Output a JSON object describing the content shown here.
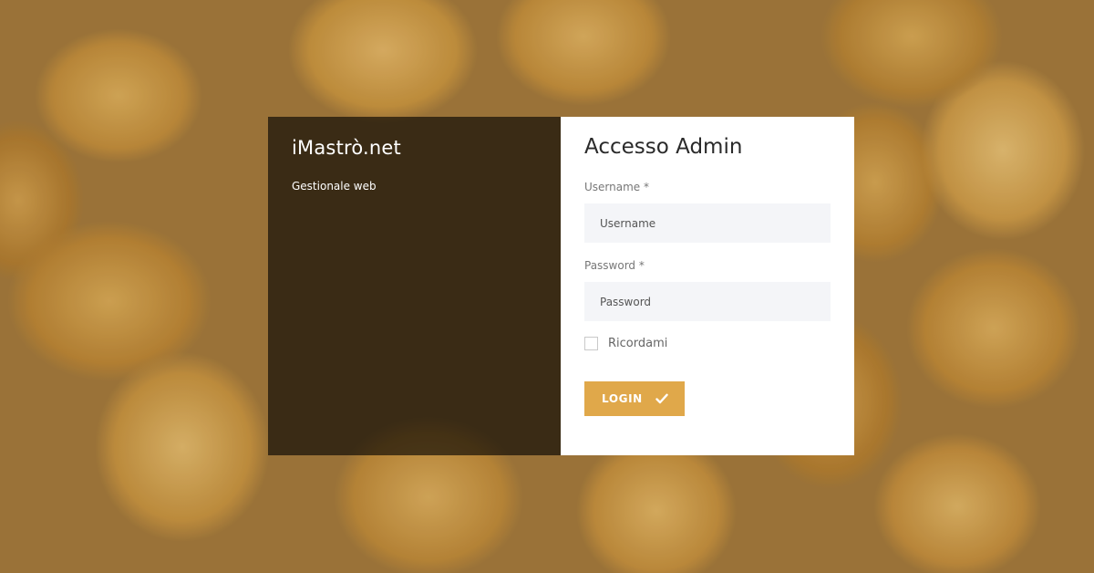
{
  "brand": {
    "title": "iMastrò.net",
    "subtitle": "Gestionale web"
  },
  "form": {
    "title": "Accesso Admin",
    "username_label": "Username *",
    "username_placeholder": "Username",
    "password_label": "Password *",
    "password_placeholder": "Password",
    "remember_label": "Ricordami",
    "remember_checked": false,
    "login_label": "LOGIN",
    "login_icon": "check-icon"
  },
  "colors": {
    "accent": "#e0a84a",
    "input_bg": "#f4f5f8",
    "overlay": "rgba(0,0,0,0.62)"
  }
}
